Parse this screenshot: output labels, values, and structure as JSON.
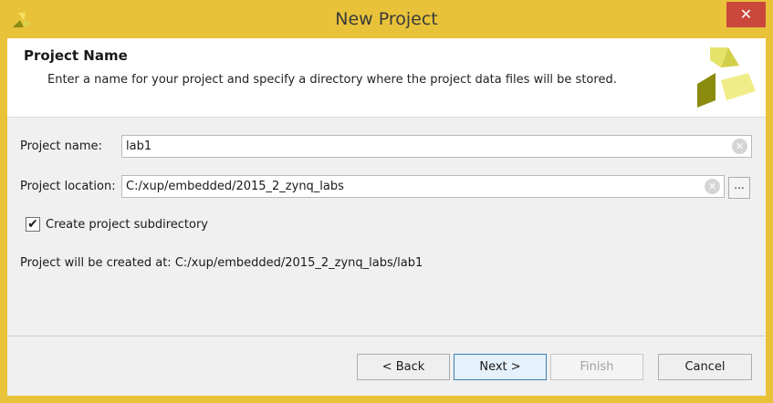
{
  "window": {
    "title": "New Project",
    "close_label": "✕"
  },
  "header": {
    "title": "Project Name",
    "description": "Enter a name for your project and specify a directory where the project data files will be stored."
  },
  "form": {
    "name_label": "Project name:",
    "name_value": "lab1",
    "location_label": "Project location:",
    "location_value": "C:/xup/embedded/2015_2_zynq_labs",
    "browse_label": "...",
    "subdir_checked": true,
    "subdir_checkmark": "✔",
    "subdir_label": "Create project subdirectory",
    "created_at_text": "Project will be created at: C:/xup/embedded/2015_2_zynq_labs/lab1",
    "clear_glyph": "✕"
  },
  "buttons": {
    "back": "< Back",
    "next": "Next >",
    "finish": "Finish",
    "cancel": "Cancel"
  },
  "colors": {
    "frame": "#e8c33a",
    "close": "#c9473b",
    "logo_dark": "#8b8b10",
    "logo_light": "#e6e36a"
  },
  "icons": [
    "app-icon",
    "close-icon",
    "clear-icon",
    "xilinx-logo",
    "checkbox-checked"
  ]
}
